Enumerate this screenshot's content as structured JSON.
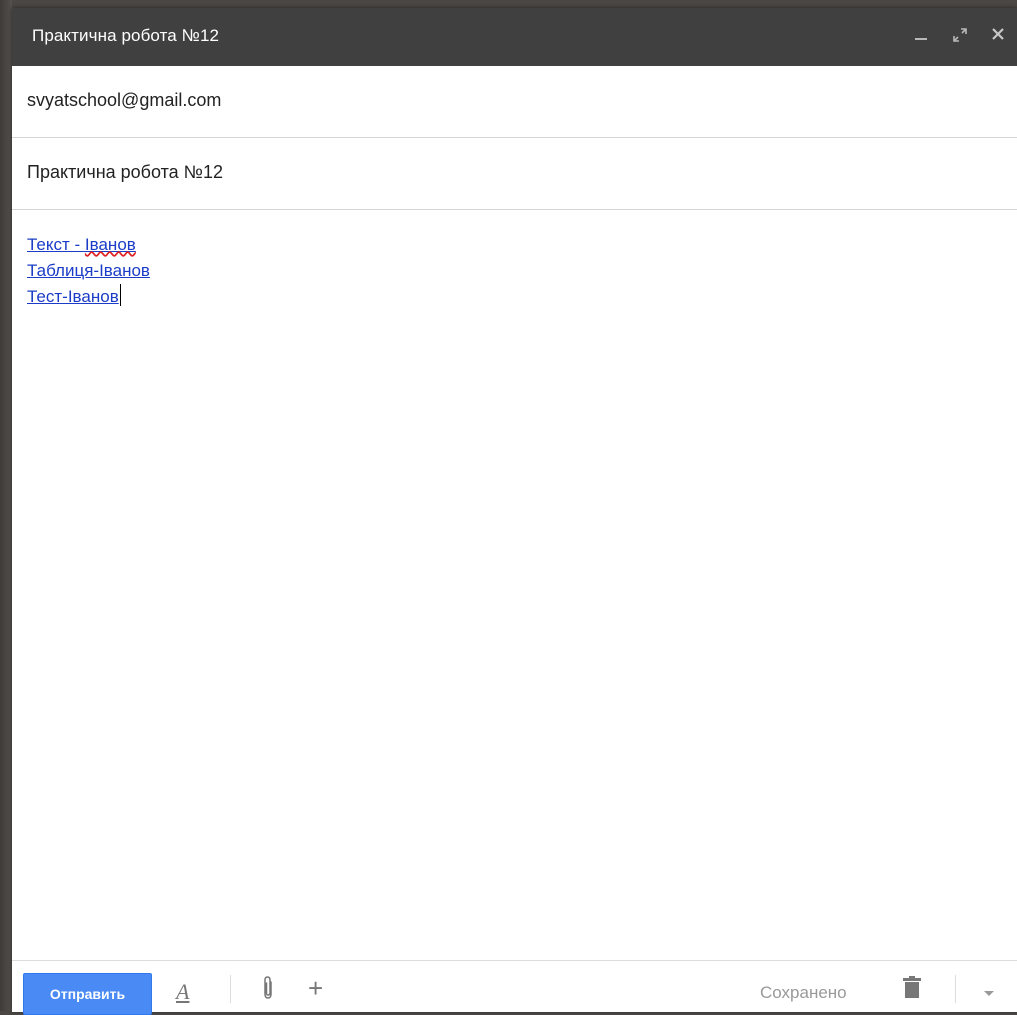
{
  "window": {
    "title": "Практична робота №12",
    "controls": {
      "minimize_icon": "minimize-icon",
      "maximize_icon": "maximize-icon",
      "close_icon": "close-icon"
    }
  },
  "compose": {
    "to": "svyatschool@gmail.com",
    "subject": "Практична робота №12",
    "body_links": [
      {
        "prefix": "Текст - ",
        "word": "Іванов"
      },
      {
        "text": "Таблиця-Іванов"
      },
      {
        "text": "Тест-Іванов"
      }
    ]
  },
  "footer": {
    "send_label": "Отправить",
    "format_label": "A",
    "more_label": "+",
    "status": "Сохранено"
  },
  "colors": {
    "titlebar": "#404040",
    "send_button": "#4a8af4",
    "link": "#1a3cc8"
  }
}
